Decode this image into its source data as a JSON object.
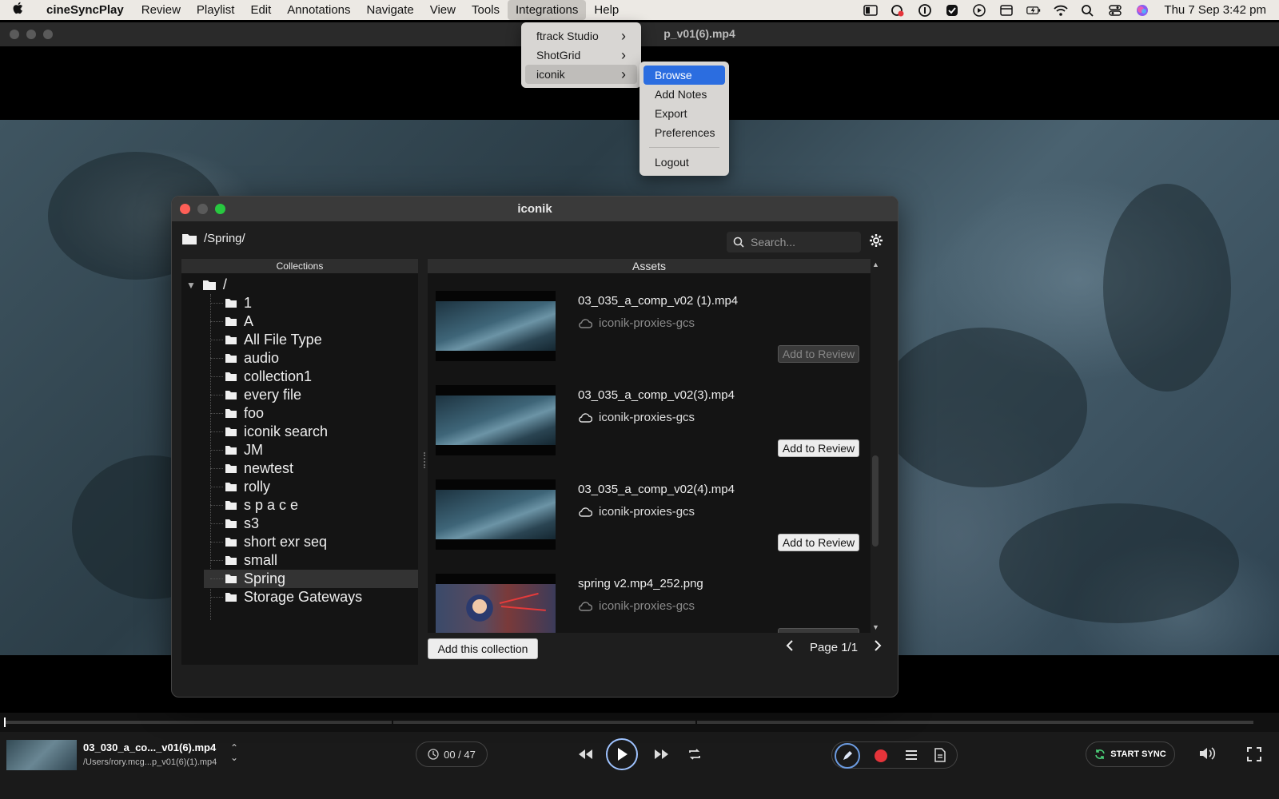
{
  "menubar": {
    "app_name": "cineSyncPlay",
    "items": [
      "Review",
      "Playlist",
      "Edit",
      "Annotations",
      "Navigate",
      "View",
      "Tools",
      "Integrations",
      "Help"
    ],
    "active_item": "Integrations",
    "clock": "Thu 7 Sep  3:42 pm"
  },
  "window": {
    "title": "p_v01(6).mp4"
  },
  "integrations_menu": {
    "items": [
      "ftrack Studio",
      "ShotGrid",
      "iconik"
    ],
    "highlighted": "iconik"
  },
  "iconik_submenu": {
    "items": [
      "Browse",
      "Add Notes",
      "Export",
      "Preferences"
    ],
    "logout": "Logout",
    "selected": "Browse"
  },
  "dialog": {
    "title": "iconik",
    "path": "/Spring/",
    "search_placeholder": "Search...",
    "collections_header": "Collections",
    "assets_header": "Assets",
    "root_label": "/",
    "collections": [
      "1",
      "A",
      "All File Type",
      "audio",
      "collection1",
      "every file",
      "foo",
      "iconik search",
      "JM",
      "newtest",
      "rolly",
      "s p a c e",
      "s3",
      "short exr seq",
      "small",
      "Spring",
      "Storage Gateways"
    ],
    "selected_collection": "Spring",
    "assets": [
      {
        "name": "03_035_a_comp_v02 (1).mp4",
        "storage": "iconik-proxies-gcs",
        "button": "Add to Review",
        "enabled": false
      },
      {
        "name": "03_035_a_comp_v02(3).mp4",
        "storage": "iconik-proxies-gcs",
        "button": "Add to Review",
        "enabled": true
      },
      {
        "name": "03_035_a_comp_v02(4).mp4",
        "storage": "iconik-proxies-gcs",
        "button": "Add to Review",
        "enabled": true
      },
      {
        "name": "spring v2.mp4_252.png",
        "storage": "iconik-proxies-gcs",
        "button": "Add to Review",
        "enabled": false
      }
    ],
    "add_collection_button": "Add this collection",
    "page_label": "Page 1/1"
  },
  "player": {
    "media_name": "03_030_a_co..._v01(6).mp4",
    "media_path": "/Users/rory.mcg...p_v01(6)(1).mp4",
    "frame_counter": "00 / 47",
    "sync_label": "START SYNC"
  },
  "colors": {
    "menu_selection": "#2b6de0",
    "record": "#e5343a",
    "close": "#fe5f57",
    "minimize": "#febc2e",
    "zoom": "#28c840"
  }
}
